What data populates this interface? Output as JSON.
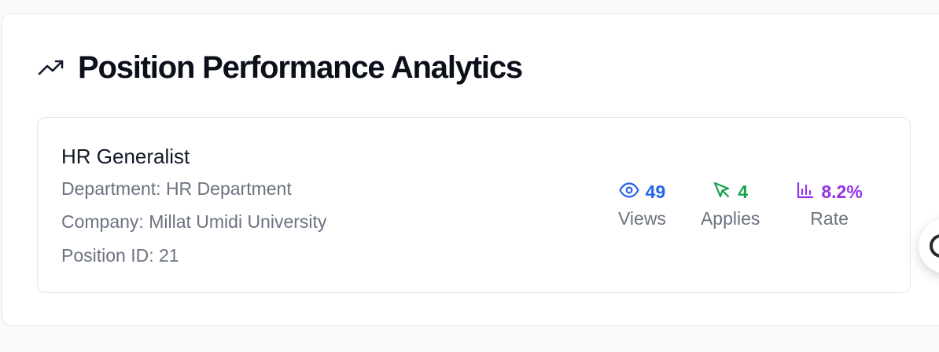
{
  "panel": {
    "title": "Position Performance Analytics",
    "icon": "trending-up-icon"
  },
  "position": {
    "title": "HR Generalist",
    "department": "Department: HR Department",
    "company": "Company: Millat Umidi University",
    "position_id": "Position ID: 21"
  },
  "metrics": {
    "views": {
      "value": "49",
      "label": "Views",
      "icon": "eye-icon",
      "color": "#2563eb"
    },
    "applies": {
      "value": "4",
      "label": "Applies",
      "icon": "cursor-pointer-icon",
      "color": "#16a34a"
    },
    "rate": {
      "value": "8.2%",
      "label": "Rate",
      "icon": "bar-chart-icon",
      "color": "#9333ea"
    }
  },
  "floating_button": {
    "icon": "chat-icon"
  }
}
